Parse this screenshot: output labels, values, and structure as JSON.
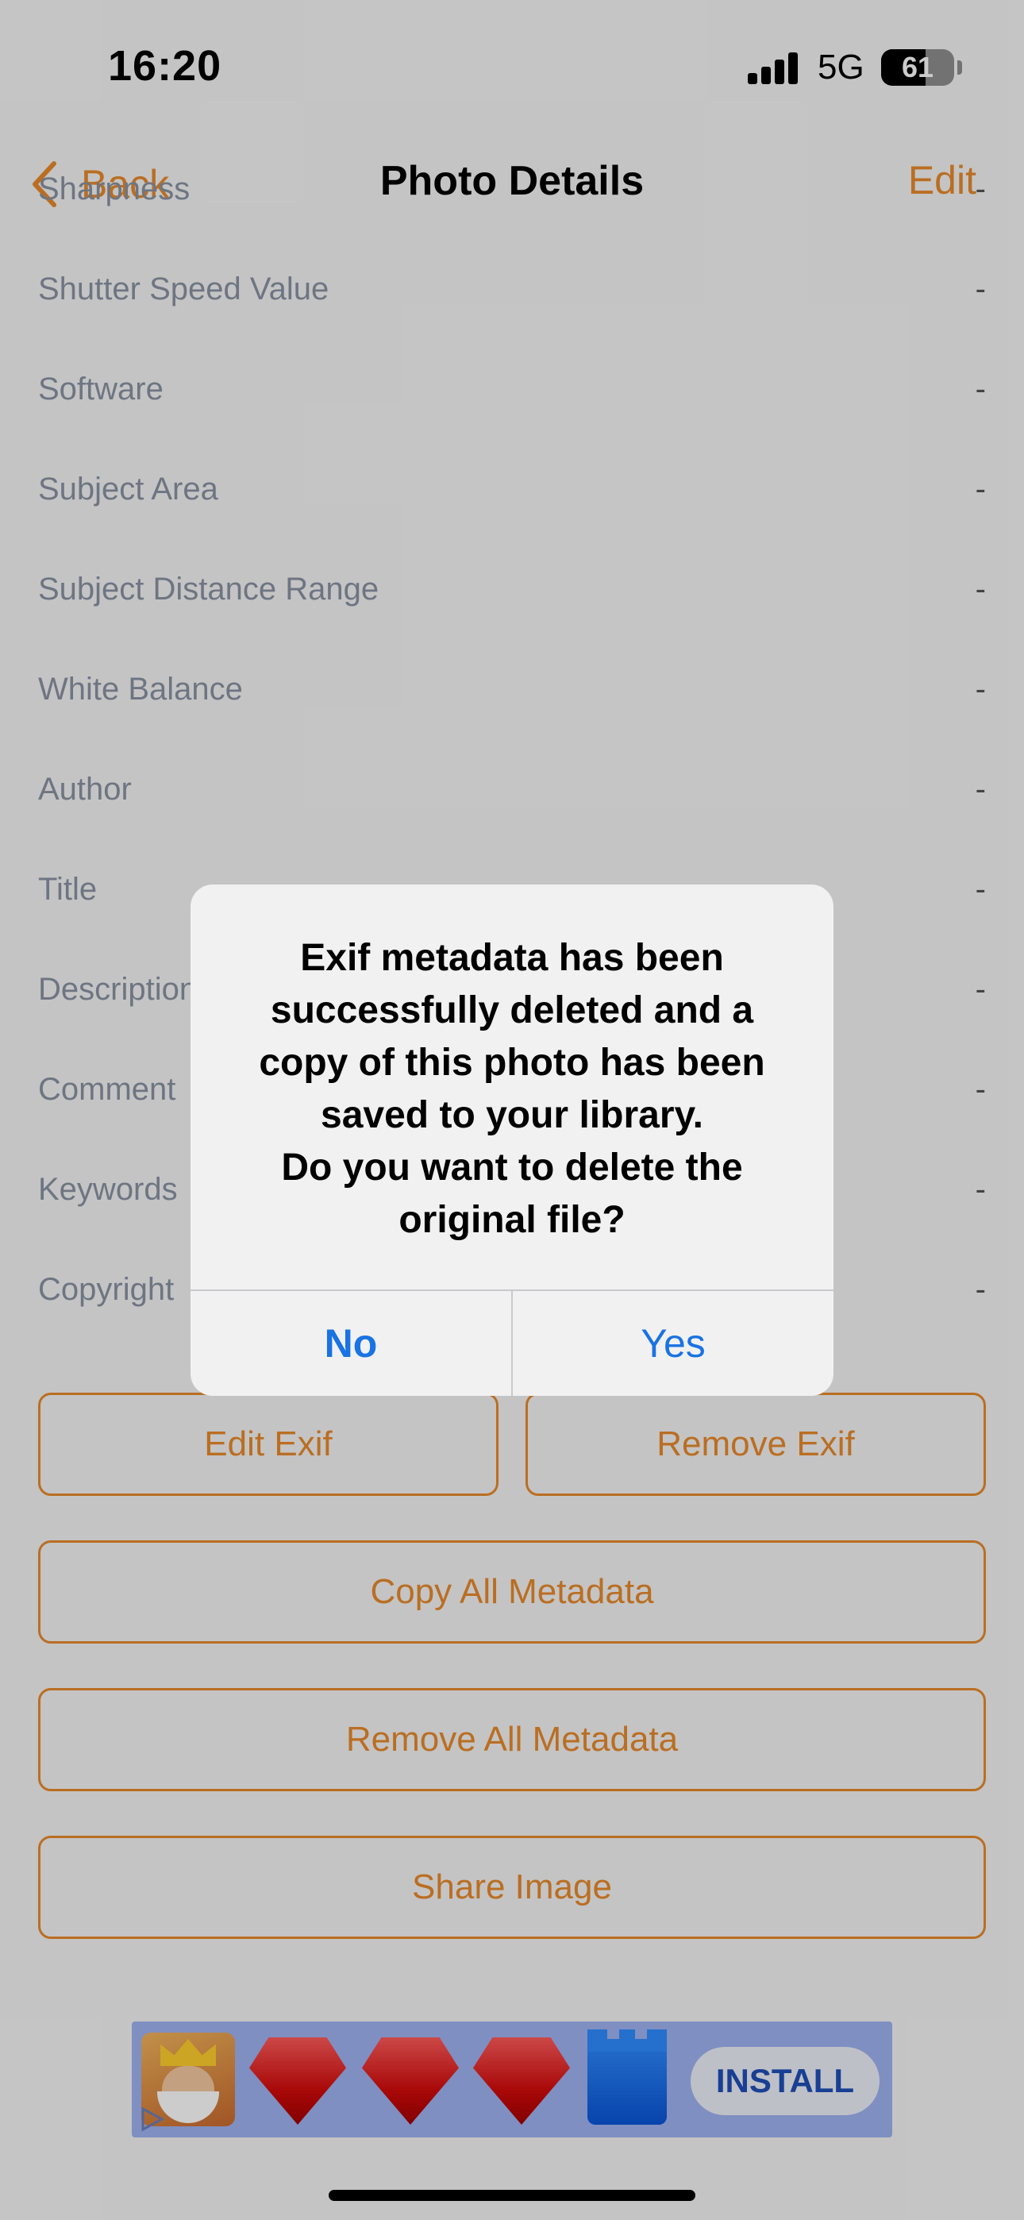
{
  "status_bar": {
    "time": "16:20",
    "network": "5G",
    "battery": "61",
    "battery_level": 0.61
  },
  "nav": {
    "back_label": "Back",
    "title": "Photo Details",
    "edit_label": "Edit"
  },
  "rows": [
    {
      "label": "Sharpness",
      "value": "-"
    },
    {
      "label": "Shutter Speed Value",
      "value": "-"
    },
    {
      "label": "Software",
      "value": "-"
    },
    {
      "label": "Subject Area",
      "value": "-"
    },
    {
      "label": "Subject Distance Range",
      "value": "-"
    },
    {
      "label": "White Balance",
      "value": "-"
    },
    {
      "label": "Author",
      "value": "-"
    },
    {
      "label": "Title",
      "value": "-"
    },
    {
      "label": "Description",
      "value": "-"
    },
    {
      "label": "Comment",
      "value": "-"
    },
    {
      "label": "Keywords",
      "value": "-"
    },
    {
      "label": "Copyright",
      "value": "-"
    }
  ],
  "actions": {
    "edit_exif": "Edit Exif",
    "remove_exif": "Remove Exif",
    "copy_all": "Copy All Metadata",
    "remove_all": "Remove All Metadata",
    "share": "Share Image"
  },
  "ad": {
    "install_label": "INSTALL"
  },
  "alert": {
    "message": "Exif metadata has been successfully deleted and a copy of this photo has been saved to your library. Do you want to delete the original file?",
    "message_lines": [
      "Exif metadata has been",
      "successfully deleted and a",
      "copy of this photo has been",
      "saved to your library.",
      "Do you want to delete the",
      "original file?"
    ],
    "no_label": "No",
    "yes_label": "Yes"
  },
  "colors": {
    "accent": "#e98a2b",
    "alert_button": "#1a73e3",
    "row_label": "#8a93a3"
  }
}
